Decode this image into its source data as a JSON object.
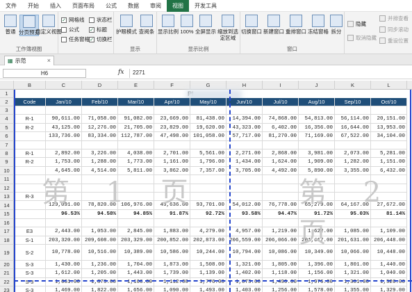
{
  "menu": {
    "tabs": [
      "文件",
      "开始",
      "插入",
      "页面布局",
      "公式",
      "数据",
      "审阅",
      "视图",
      "开发工具"
    ],
    "active": "视图"
  },
  "ribbon": {
    "view_group": {
      "buttons": [
        "普通",
        "分页预览",
        "自定义视图"
      ],
      "label": "工作簿视图"
    },
    "show_group": {
      "checks": [
        "网格线",
        "状态栏",
        "公式",
        "标题",
        "任务窗格",
        "切换栏"
      ],
      "checked": [
        true,
        false,
        false,
        true,
        false,
        true
      ]
    },
    "mode_group": {
      "buttons": [
        "护眼模式",
        "查阅条"
      ]
    },
    "zoom_group": {
      "buttons": [
        "显示比例",
        "100%",
        "全屏显示",
        "缩放到选定区域"
      ],
      "label": "显示比例",
      "show_label": "显示"
    },
    "window_group": {
      "buttons": [
        "切换窗口",
        "新建窗口",
        "重排窗口",
        "冻结窗格",
        "拆分"
      ],
      "label": "窗口"
    },
    "extra": {
      "hide": "隐藏",
      "unhide": "取消隐藏",
      "side_by_side": "并排查看",
      "sync_scroll": "同步滚动",
      "reset_pos": "重设位置"
    }
  },
  "doc_tab": {
    "name": "示范"
  },
  "formula_bar": {
    "namebox": "H6",
    "fx": "fx",
    "value": "2271"
  },
  "columns": [
    "B",
    "C",
    "D",
    "E",
    "F",
    "G",
    "H",
    "I",
    "J",
    "K",
    "L"
  ],
  "title_text": "Pl",
  "header_row": [
    "Code",
    "Jan/10",
    "Feb/10",
    "Mar/10",
    "Apr/10",
    "May/10",
    "Jun/10",
    "Jul/10",
    "Aug/10",
    "Sep/10",
    "Oct/10"
  ],
  "rows": [
    {
      "n": "3",
      "cells": [
        "",
        "",
        "",
        "",
        "",
        "",
        "",
        "",
        "",
        "",
        ""
      ]
    },
    {
      "n": "4",
      "cells": [
        "R-1",
        "90,611.00",
        "71,058.00",
        "91,082.00",
        "23,669.00",
        "81,438.00",
        "14,394.00",
        "74,868.00",
        "54,813.00",
        "56,114.00",
        "20,151.00"
      ]
    },
    {
      "n": "5",
      "cells": [
        "R-2",
        "43,125.00",
        "12,276.00",
        "21,705.00",
        "23,829.00",
        "19,620.00",
        "43,323.00",
        "6,402.00",
        "16,356.00",
        "16,644.00",
        "13,953.00"
      ]
    },
    {
      "n": "6",
      "cells": [
        "",
        "133,736.00",
        "83,334.00",
        "112,787.00",
        "47,498.00",
        "101,058.00",
        "57,717.00",
        "81,270.00",
        "71,169.00",
        "67,522.00",
        "34,104.00"
      ]
    },
    {
      "n": "7",
      "cells": [
        "",
        "",
        "",
        "",
        "",
        "",
        "",
        "",
        "",
        "",
        ""
      ]
    },
    {
      "n": "8",
      "cells": [
        "R-1",
        "2,892.00",
        "3,226.00",
        "4,038.00",
        "2,701.00",
        "5,561.00",
        "2,271.00",
        "2,868.00",
        "3,981.00",
        "2,073.00",
        "5,281.00"
      ]
    },
    {
      "n": "9",
      "cells": [
        "R-2",
        "1,753.00",
        "1,288.00",
        "1,773.00",
        "1,161.00",
        "1,796.00",
        "1,434.00",
        "1,624.00",
        "1,909.00",
        "1,282.00",
        "1,151.00"
      ]
    },
    {
      "n": "10",
      "cells": [
        "",
        "4,645.00",
        "4,514.00",
        "5,811.00",
        "3,862.00",
        "7,357.00",
        "3,705.00",
        "4,492.00",
        "5,890.00",
        "3,355.00",
        "6,432.00"
      ]
    },
    {
      "n": "11",
      "cells": [
        "",
        "",
        "",
        "",
        "",
        "",
        "",
        "",
        "",
        "",
        ""
      ]
    },
    {
      "n": "12",
      "cells": [
        "",
        "",
        "",
        "",
        "",
        "",
        "",
        "",
        "",
        "",
        ""
      ]
    },
    {
      "n": "13",
      "cells": [
        "R-3",
        "",
        "",
        "",
        "",
        "",
        "",
        "",
        "",
        "",
        ""
      ]
    },
    {
      "n": "14",
      "cells": [
        "",
        "129,091.00",
        "78,820.00",
        "106,976.00",
        "43,636.00",
        "93,701.00",
        "54,012.00",
        "76,778.00",
        "65,279.00",
        "64,167.00",
        "27,672.00"
      ]
    },
    {
      "n": "15",
      "cells": [
        "",
        "96.53%",
        "94.58%",
        "94.85%",
        "91.87%",
        "92.72%",
        "93.58%",
        "94.47%",
        "91.72%",
        "95.03%",
        "81.14%"
      ]
    },
    {
      "n": "16",
      "cells": [
        "",
        "",
        "",
        "",
        "",
        "",
        "",
        "",
        "",
        "",
        ""
      ]
    },
    {
      "n": "17",
      "cells": [
        "E3",
        "2,443.00",
        "1,053.00",
        "2,845.00",
        "1,883.00",
        "4,279.00",
        "4,957.00",
        "1,219.00",
        "1,622.00",
        "1,085.00",
        "1,109.00"
      ]
    },
    {
      "n": "18",
      "cells": [
        "S-1",
        "203,320.00",
        "209,608.00",
        "203,329.00",
        "200,852.00",
        "202,873.00",
        "206,559.00",
        "206,066.00",
        "201,617.00",
        "201,631.00",
        "206,448.00"
      ]
    },
    {
      "n": "19",
      "cells": [
        "S-2",
        "10,778.00",
        "10,516.00",
        "10,389.00",
        "10,586.00",
        "10,244.00",
        "10,794.00",
        "10,086.00",
        "10,349.00",
        "10,066.00",
        "10,448.00"
      ]
    },
    {
      "n": "20",
      "cells": [
        "S-3",
        "1,430.00",
        "1,236.00",
        "1,704.00",
        "1,873.00",
        "1,508.00",
        "1,321.00",
        "1,805.00",
        "1,396.00",
        "1,801.00",
        "1,440.00"
      ]
    },
    {
      "n": "21",
      "cells": [
        "S-3",
        "1,612.00",
        "1,205.00",
        "1,443.00",
        "1,739.00",
        "1,139.00",
        "1,402.00",
        "1,118.00",
        "1,156.00",
        "1,321.00",
        "1,040.00"
      ]
    },
    {
      "n": "22",
      "cells": [
        "S-3",
        "1,661.00",
        "1,873.00",
        "1,166.00",
        "1,112.00",
        "1,776.00",
        "1,073.00",
        "1,490.00",
        "1,976.00",
        "1,301.00",
        "1,526.00"
      ]
    },
    {
      "n": "23",
      "cells": [
        "S-3",
        "1,469.00",
        "1,822.00",
        "1,656.00",
        "1,090.00",
        "1,493.00",
        "1,403.00",
        "1,256.00",
        "1,578.00",
        "1,355.00",
        "1,329.00"
      ]
    },
    {
      "n": "24",
      "cells": [
        "",
        "1,175.00",
        "1,510.00",
        "1,160.00",
        "1,996.00",
        "1,719.00",
        "1,828.00",
        "1,287.00",
        "1,635.00",
        "1,333.00",
        "1,139.00"
      ]
    }
  ],
  "watermarks": [
    "第 1 页",
    "第 2 页"
  ]
}
